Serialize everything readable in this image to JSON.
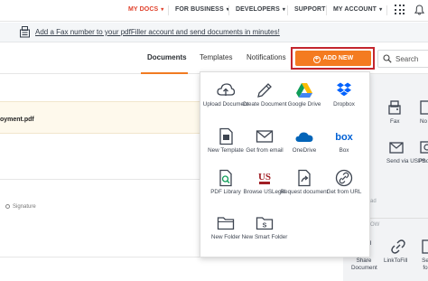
{
  "nav": {
    "my_docs": "MY DOCS",
    "for_business": "FOR BUSINESS",
    "developers": "DEVELOPERS",
    "support": "SUPPORT",
    "my_account": "MY ACCOUNT",
    "chevron": "▾"
  },
  "banner": {
    "text": "Add a Fax number to your pdfFiller account and send documents in minutes!"
  },
  "tabs": {
    "documents": "Documents",
    "templates": "Templates",
    "notifications": "Notifications"
  },
  "add_new": {
    "label": "ADD NEW",
    "plus": "+"
  },
  "search": {
    "placeholder": "Search"
  },
  "documents": {
    "file_name": "oyment.pdf",
    "signature_label": "Signature"
  },
  "dropdown": {
    "items": [
      {
        "label": "Upload Document",
        "icon": "cloud-upload-icon"
      },
      {
        "label": "Create Document",
        "icon": "pen-icon"
      },
      {
        "label": "Google Drive",
        "icon": "google-drive-icon"
      },
      {
        "label": "Dropbox",
        "icon": "dropbox-icon"
      },
      {
        "label": "New Template",
        "icon": "template-icon"
      },
      {
        "label": "Get from email",
        "icon": "email-icon"
      },
      {
        "label": "OneDrive",
        "icon": "onedrive-icon"
      },
      {
        "label": "Box",
        "icon": "box-icon"
      },
      {
        "label": "PDF Library",
        "icon": "pdf-library-icon"
      },
      {
        "label": "Browse USLegal",
        "icon": "uslegal-icon"
      },
      {
        "label": "Request document",
        "icon": "request-document-icon"
      },
      {
        "label": "Get from URL",
        "icon": "link-icon"
      },
      {
        "label": "New Folder",
        "icon": "folder-icon"
      },
      {
        "label": "New Smart Folder",
        "icon": "smart-folder-icon"
      }
    ]
  },
  "right_panel": {
    "fax": "Fax",
    "notarize": "No",
    "send_via_usps": "Send via USPS",
    "pho": "Pho",
    "ad": "ad",
    "ow": "OW",
    "share_document": "Share Document",
    "linktofill": "LinkToFill",
    "se_fo": "Se fo"
  },
  "colors": {
    "brand_orange": "#f47b20",
    "active_nav_red": "#e0402b",
    "highlight_frame": "#c4262e",
    "google_drive_green": "#0f9d58",
    "dropbox_blue": "#0061fe",
    "onedrive_blue": "#0364b8",
    "box_blue": "#0061d5",
    "uslegal_red": "#a01e24"
  }
}
